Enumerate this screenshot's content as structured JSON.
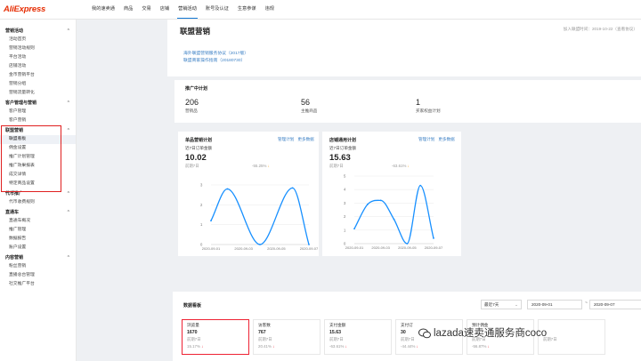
{
  "brand": {
    "logo_text": "AliExpress"
  },
  "topnav": [
    "我的速卖通",
    "商品",
    "交易",
    "店铺",
    "营销活动",
    "账号及认证",
    "生意参谋",
    "违规"
  ],
  "topnav_active_index": 4,
  "sidebar": {
    "groups": [
      {
        "label": "营销活动",
        "items": [
          "活动首页",
          "营销活动规则",
          "平台活动",
          "店铺活动",
          "金币营销平台",
          "营销分组",
          "营销流量转化"
        ]
      },
      {
        "label": "客户管理与营销",
        "items": [
          "客户管理",
          "客户营销"
        ]
      },
      {
        "label": "联盟营销",
        "items": [
          "联盟看板",
          "佣金设置",
          "推广计划管理",
          "推广效果报表",
          "成交详情",
          "特定商品设置"
        ]
      },
      {
        "label": "代币推广",
        "items": [
          "代币收费规则"
        ]
      },
      {
        "label": "直通车",
        "items": [
          "直通车概况",
          "推广管理",
          "数据报告",
          "账户设置"
        ]
      },
      {
        "label": "内容营销",
        "items": [
          "粉丝营销",
          "直播总台管理",
          "社交推广平台"
        ]
      }
    ],
    "active_item": "联盟看板"
  },
  "header": {
    "title": "联盟营销",
    "join_time": "加入联盟时间：2019-10-22（查看协议）",
    "doc_links": [
      "海外联盟营销服务协议（2017版）",
      "联盟商家操作指南（20180730）"
    ]
  },
  "plans": {
    "title": "推广中计划",
    "items": [
      {
        "value": "206",
        "label": "营销品"
      },
      {
        "value": "56",
        "label": "主推商品"
      },
      {
        "value": "1",
        "label": "买家权益计划"
      }
    ]
  },
  "chart_panels": [
    {
      "title": "单品营销计划",
      "links": [
        "管理计划",
        "更多数据"
      ],
      "subtitle": "近7日订单金额",
      "value": "10.02",
      "prev_label": "前期7日",
      "change": "-55.25%",
      "chart_data": {
        "type": "line",
        "x": [
          "2020-09-01",
          "2020-09-03",
          "2020-09-05",
          "2020-09-07"
        ],
        "x_ticks": [
          "2020-09-01",
          "2020-09-03",
          "2020-09-05",
          "2020-09-07"
        ],
        "y_ticks": [
          "0",
          "1",
          "2",
          "3"
        ],
        "ylim": [
          0,
          3
        ],
        "points": [
          {
            "x": "2020-09-01",
            "y": 1.2
          },
          {
            "x": "2020-09-02",
            "y": 2.8
          },
          {
            "x": "2020-09-04",
            "y": 0
          },
          {
            "x": "2020-09-06",
            "y": 2.85
          },
          {
            "x": "2020-09-07",
            "y": 0
          }
        ]
      }
    },
    {
      "title": "店铺通用计划",
      "links": [
        "管理计划",
        "更多数据"
      ],
      "subtitle": "近7日订单金额",
      "value": "15.63",
      "prev_label": "前期7日",
      "change": "-63.61%",
      "chart_data": {
        "type": "line",
        "x": [
          "2020-09-01",
          "2020-09-03",
          "2020-09-05",
          "2020-09-07"
        ],
        "x_ticks": [
          "2020-09-01",
          "2020-09-03",
          "2020-09-05",
          "2020-09-07"
        ],
        "y_ticks": [
          "0",
          "1",
          "2",
          "3",
          "4",
          "5"
        ],
        "ylim": [
          0,
          5
        ],
        "points": [
          {
            "x": "2020-09-01",
            "y": 1.1
          },
          {
            "x": "2020-09-02",
            "y": 2.9
          },
          {
            "x": "2020-09-03",
            "y": 3.2
          },
          {
            "x": "2020-09-04",
            "y": 1.8
          },
          {
            "x": "2020-09-05",
            "y": 0
          },
          {
            "x": "2020-09-06",
            "y": 4.3
          },
          {
            "x": "2020-09-07",
            "y": 0.4
          }
        ]
      }
    }
  ],
  "dashboard": {
    "title": "数据看板",
    "range_select": "最近7天",
    "date_from": "2020-09-01",
    "date_to": "2020-09-07",
    "metrics": [
      {
        "label": "浏览量",
        "value": "1670",
        "prev": "前期7日",
        "change": "15.17%"
      },
      {
        "label": "访客数",
        "value": "767",
        "prev": "前期7日",
        "change": "20.41%"
      },
      {
        "label": "支付金额",
        "value": "15.63",
        "prev": "前期7日",
        "change": "-63.61%"
      },
      {
        "label": "支付订",
        "value": "30",
        "prev": "前期7日",
        "change": "-44.44%"
      },
      {
        "label": "预计佣金",
        "value": "",
        "prev": "前期7日",
        "change": "-56.87%"
      },
      {
        "label": "",
        "value": "",
        "prev": "前期7日",
        "change": ""
      }
    ]
  },
  "watermark": {
    "text": "lazada速卖通服务商coco"
  },
  "colors": {
    "brand": "#e62e04",
    "link": "#3a7fc4",
    "line": "#1890ff",
    "highlight": "#e02020"
  }
}
